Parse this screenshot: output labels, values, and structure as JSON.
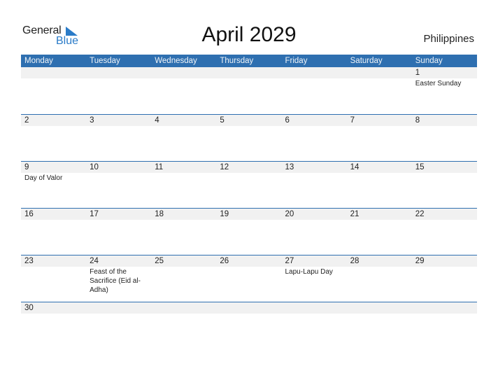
{
  "logo": {
    "word1": "General",
    "word2": "Blue",
    "icon": "triangle-flag-icon"
  },
  "header": {
    "title": "April 2029",
    "country": "Philippines"
  },
  "colors": {
    "accent": "#2e6fb0",
    "logo_blue": "#2a7bc8",
    "strip": "#f1f1f1"
  },
  "weekdays": [
    "Monday",
    "Tuesday",
    "Wednesday",
    "Thursday",
    "Friday",
    "Saturday",
    "Sunday"
  ],
  "weeks": [
    [
      {
        "day": "",
        "event": ""
      },
      {
        "day": "",
        "event": ""
      },
      {
        "day": "",
        "event": ""
      },
      {
        "day": "",
        "event": ""
      },
      {
        "day": "",
        "event": ""
      },
      {
        "day": "",
        "event": ""
      },
      {
        "day": "1",
        "event": "Easter Sunday"
      }
    ],
    [
      {
        "day": "2",
        "event": ""
      },
      {
        "day": "3",
        "event": ""
      },
      {
        "day": "4",
        "event": ""
      },
      {
        "day": "5",
        "event": ""
      },
      {
        "day": "6",
        "event": ""
      },
      {
        "day": "7",
        "event": ""
      },
      {
        "day": "8",
        "event": ""
      }
    ],
    [
      {
        "day": "9",
        "event": "Day of Valor"
      },
      {
        "day": "10",
        "event": ""
      },
      {
        "day": "11",
        "event": ""
      },
      {
        "day": "12",
        "event": ""
      },
      {
        "day": "13",
        "event": ""
      },
      {
        "day": "14",
        "event": ""
      },
      {
        "day": "15",
        "event": ""
      }
    ],
    [
      {
        "day": "16",
        "event": ""
      },
      {
        "day": "17",
        "event": ""
      },
      {
        "day": "18",
        "event": ""
      },
      {
        "day": "19",
        "event": ""
      },
      {
        "day": "20",
        "event": ""
      },
      {
        "day": "21",
        "event": ""
      },
      {
        "day": "22",
        "event": ""
      }
    ],
    [
      {
        "day": "23",
        "event": ""
      },
      {
        "day": "24",
        "event": "Feast of the Sacrifice (Eid al-Adha)"
      },
      {
        "day": "25",
        "event": ""
      },
      {
        "day": "26",
        "event": ""
      },
      {
        "day": "27",
        "event": "Lapu-Lapu Day"
      },
      {
        "day": "28",
        "event": ""
      },
      {
        "day": "29",
        "event": ""
      }
    ],
    [
      {
        "day": "30",
        "event": ""
      },
      {
        "day": "",
        "event": ""
      },
      {
        "day": "",
        "event": ""
      },
      {
        "day": "",
        "event": ""
      },
      {
        "day": "",
        "event": ""
      },
      {
        "day": "",
        "event": ""
      },
      {
        "day": "",
        "event": ""
      }
    ]
  ]
}
